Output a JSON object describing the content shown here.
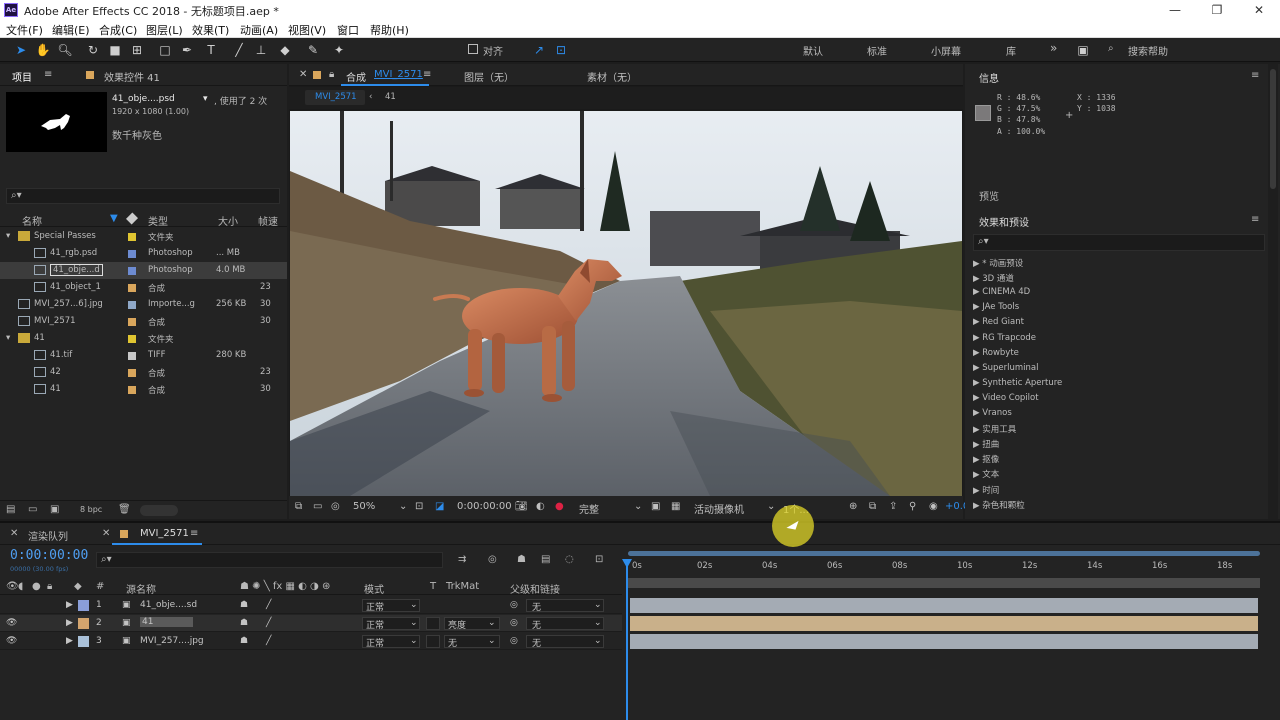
{
  "window": {
    "title": "Adobe After Effects CC 2018 - 无标题项目.aep *",
    "app_icon_text": "Ae",
    "controls": [
      "—",
      "❐",
      "✕"
    ]
  },
  "menu": [
    "文件(F)",
    "编辑(E)",
    "合成(C)",
    "图层(L)",
    "效果(T)",
    "动画(A)",
    "视图(V)",
    "窗口",
    "帮助(H)"
  ],
  "toolbar": {
    "align_label": "对齐",
    "workspaces": [
      "默认",
      "标准",
      "小屏幕",
      "库"
    ],
    "more": "»",
    "search_help": "搜索帮助"
  },
  "project_panel": {
    "tab_project": "项目",
    "tab_effects": "效果控件 41",
    "preview_name": "41_obje....psd",
    "preview_used": ", 使用了 2 次",
    "preview_dims": "1920 x 1080 (1.00)",
    "preview_desc": "数千种灰色",
    "search_placeholder": "⌕▾",
    "columns": {
      "name": "名称",
      "type": "类型",
      "size": "大小",
      "fps": "帧速"
    },
    "rows": [
      {
        "name": "Special Passes",
        "type": "文件夹",
        "size": "",
        "fps": "",
        "color": "#e0c531",
        "kind": "folder",
        "indent": 0
      },
      {
        "name": "41_rgb.psd",
        "type": "Photoshop",
        "size": "... MB",
        "fps": "",
        "color": "#6d8bd1",
        "kind": "psd",
        "indent": 1
      },
      {
        "name": "41_obje...d",
        "type": "Photoshop",
        "size": "4.0 MB",
        "fps": "",
        "color": "#6d8bd1",
        "kind": "psd",
        "indent": 1,
        "selected": true
      },
      {
        "name": "41_object_1",
        "type": "合成",
        "size": "",
        "fps": "23",
        "color": "#d9a65c",
        "kind": "comp",
        "indent": 1
      },
      {
        "name": "MVI_257...6].jpg",
        "type": "Importe...g",
        "size": "256 KB",
        "fps": "30",
        "color": "#8fa8c8",
        "kind": "seq",
        "indent": 0
      },
      {
        "name": "MVI_2571",
        "type": "合成",
        "size": "",
        "fps": "30",
        "color": "#d9a65c",
        "kind": "comp",
        "indent": 0
      },
      {
        "name": "41",
        "type": "文件夹",
        "size": "",
        "fps": "",
        "color": "#e0c531",
        "kind": "folder",
        "indent": 0
      },
      {
        "name": "41.tif",
        "type": "TIFF",
        "size": "280 KB",
        "fps": "",
        "color": "#c8c8c8",
        "kind": "tif",
        "indent": 1
      },
      {
        "name": "42",
        "type": "合成",
        "size": "",
        "fps": "23",
        "color": "#d9a65c",
        "kind": "comp",
        "indent": 1
      },
      {
        "name": "41",
        "type": "合成",
        "size": "",
        "fps": "30",
        "color": "#d9a65c",
        "kind": "comp",
        "indent": 1
      }
    ],
    "footer_bpc": "8 bpc"
  },
  "comp_panel": {
    "tab_comp": "合成",
    "tab_comp_name": "MVI_2571",
    "tab_layer": "图层（无）",
    "tab_footage": "素材（无）",
    "flow_items": [
      "MVI_2571",
      "‹",
      "41"
    ],
    "zoom": "50%",
    "timecode": "0:00:00:00",
    "resolution": "完整",
    "camera": "活动摄像机",
    "views": "1个...",
    "exposure": "+0.0"
  },
  "info_panel": {
    "title": "信息",
    "r": "R : 48.6%",
    "g": "G : 47.5%",
    "b": "B : 47.8%",
    "a": "A : 100.0%",
    "x": "X : 1336",
    "y": "Y : 1038",
    "preview_title": "预览",
    "effects_title": "效果和预设",
    "search_placeholder": "⌕▾",
    "categories": [
      "* 动画预设",
      "3D 通道",
      "CINEMA 4D",
      "JAe Tools",
      "Red Giant",
      "RG Trapcode",
      "Rowbyte",
      "Superluminal",
      "Synthetic Aperture",
      "Video Copilot",
      "Vranos",
      "实用工具",
      "扭曲",
      "抠像",
      "文本",
      "时间",
      "杂色和颗粒"
    ]
  },
  "timeline": {
    "tab_render": "渲染队列",
    "tab_comp": "MVI_2571",
    "timecode": "0:00:00:00",
    "frame_info": "00000 (30.00 fps)",
    "headers": {
      "source": "源名称",
      "mode": "模式",
      "t": "T",
      "trkmat": "TrkMat",
      "parent": "父级和链接"
    },
    "ruler": [
      "0s",
      "02s",
      "04s",
      "06s",
      "08s",
      "10s",
      "12s",
      "14s",
      "16s",
      "18s"
    ],
    "layers": [
      {
        "num": "1",
        "name": "41_obje....sd",
        "mode": "正常",
        "trkmat": "",
        "parent": "无",
        "color": "#8a9ed8",
        "bar": "#a4abb4",
        "eye": false
      },
      {
        "num": "2",
        "name": "41",
        "mode": "正常",
        "trkmat": "亮度",
        "parent": "无",
        "color": "#d3a46e",
        "bar": "#c9b08a",
        "eye": true
      },
      {
        "num": "3",
        "name": "MVI_257....jpg",
        "mode": "正常",
        "trkmat": "无",
        "parent": "无",
        "color": "#a9c0d8",
        "bar": "#a4abb4",
        "eye": true
      }
    ]
  }
}
